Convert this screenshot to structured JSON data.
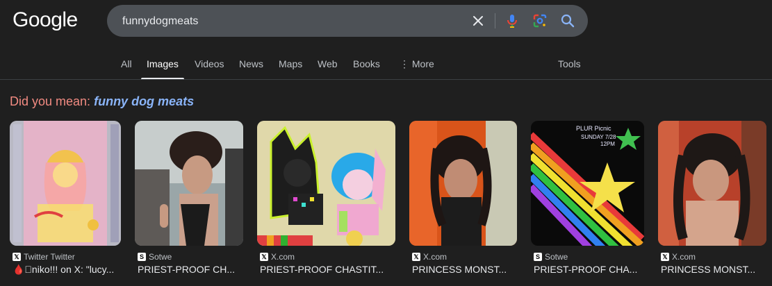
{
  "logo": "Google",
  "search": {
    "query": "funnydogmeats"
  },
  "tabs": [
    "All",
    "Images",
    "Videos",
    "News",
    "Maps",
    "Web",
    "Books",
    "More",
    "Tools"
  ],
  "did_you_mean": {
    "label": "Did you mean:",
    "suggestion": "funny dog meats"
  },
  "results": [
    {
      "source": "Twitter Twitter",
      "source_icon": "x-icon",
      "title": "🩸\u0000niko!!! on X: \"lucy..."
    },
    {
      "source": "Sotwe",
      "source_icon": "sotwe-icon",
      "title": "PRIEST-PROOF CH..."
    },
    {
      "source": "X.com",
      "source_icon": "x-icon",
      "title": "PRIEST-PROOF CHASTIT..."
    },
    {
      "source": "X.com",
      "source_icon": "x-icon",
      "title": "PRINCESS MONST..."
    },
    {
      "source": "Sotwe",
      "source_icon": "sotwe-icon",
      "title": "PRIEST-PROOF CHA..."
    },
    {
      "source": "X.com",
      "source_icon": "x-icon",
      "title": "PRINCESS MONST..."
    }
  ],
  "card3_text": {
    "name": "PLUR Picnic",
    "date": "SUNDAY 7/28",
    "time": "12PM"
  }
}
